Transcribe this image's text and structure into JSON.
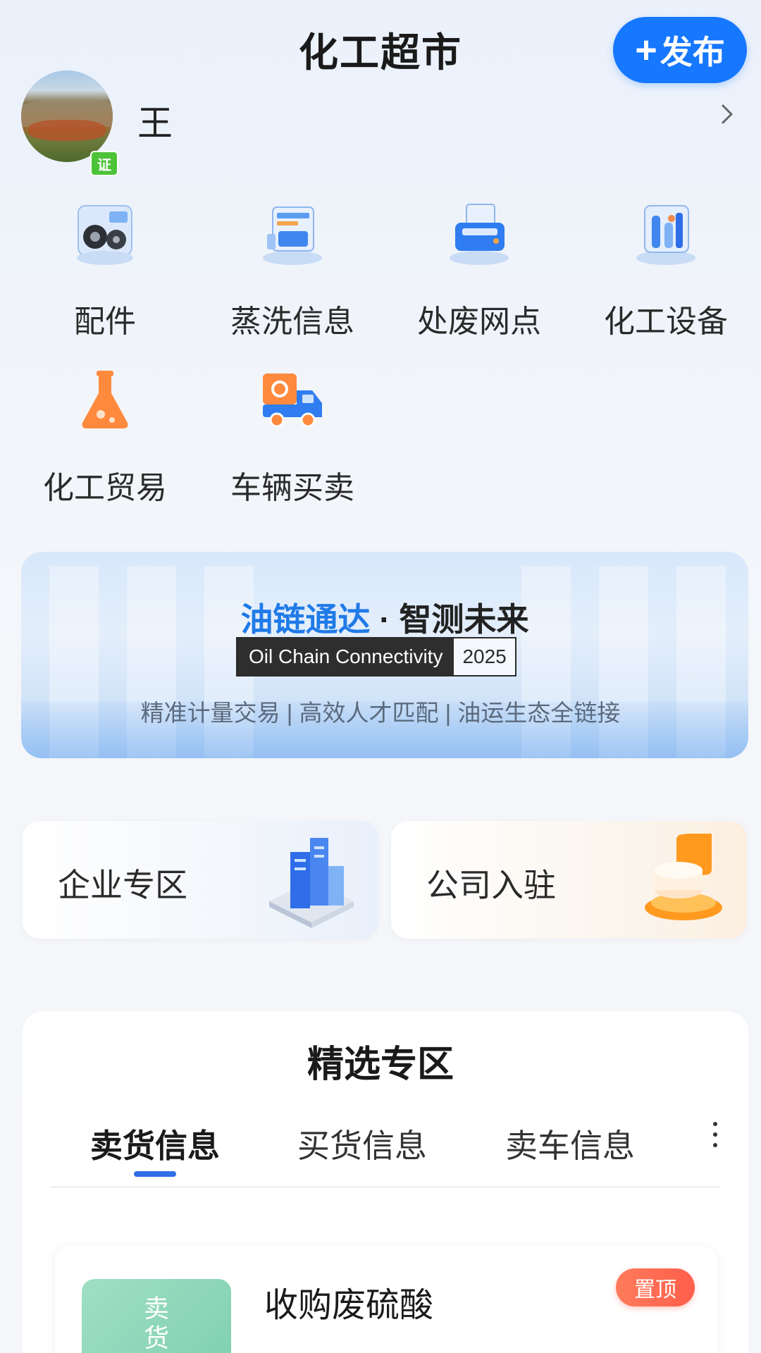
{
  "header": {
    "title": "化工超市",
    "publish_label": "发布"
  },
  "profile": {
    "name": "王",
    "verified_badge": "证"
  },
  "categories": [
    {
      "label": "配件",
      "icon": "parts-icon"
    },
    {
      "label": "蒸洗信息",
      "icon": "washer-machine-icon"
    },
    {
      "label": "处废网点",
      "icon": "waste-printer-icon"
    },
    {
      "label": "化工设备",
      "icon": "chemical-equipment-icon"
    },
    {
      "label": "化工贸易",
      "icon": "flask-icon"
    },
    {
      "label": "车辆买卖",
      "icon": "truck-icon"
    }
  ],
  "banner": {
    "title_highlight": "油链通达",
    "title_separator": "·",
    "title_rest": "智测未来",
    "tag_dark": "Oil Chain Connectivity",
    "tag_year": "2025",
    "subtitle": "精准计量交易 | 高效人才匹配 | 油运生态全链接"
  },
  "zones": [
    {
      "label": "企业专区",
      "icon": "building-icon"
    },
    {
      "label": "公司入驻",
      "icon": "office-join-icon"
    }
  ],
  "featured": {
    "title": "精选专区",
    "tabs": [
      "卖货信息",
      "买货信息",
      "卖车信息"
    ],
    "active_tab": "卖货信息",
    "items": [
      {
        "thumb_text": "卖货",
        "title": "收购废硫酸",
        "badge": "置顶"
      }
    ]
  },
  "colors": {
    "accent": "#1677ff",
    "verified": "#4cc338",
    "pin": "#ff5e4c"
  }
}
